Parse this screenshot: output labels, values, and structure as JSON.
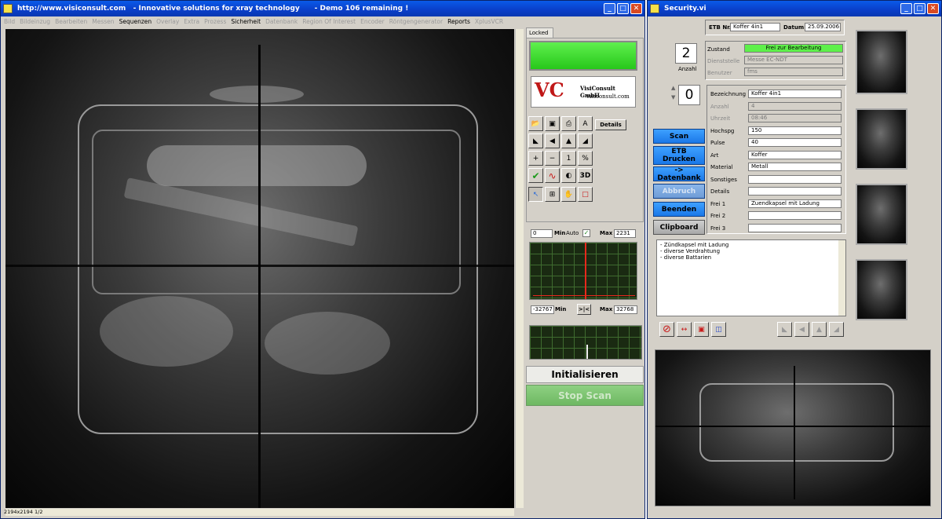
{
  "win1": {
    "url": "http://www.visiconsult.com",
    "tagline": "-  Innovative solutions for xray technology",
    "demo": "-  Demo 106 remaining !",
    "menu": [
      "Bild",
      "Bildeinzug",
      "Bearbeiten",
      "Messen",
      "Sequenzen",
      "Overlay",
      "Extra",
      "Prozess",
      "Sicherheit",
      "Datenbank",
      "Region Of Interest",
      "Encoder",
      "Röntgengenerator",
      "Reports",
      "XplusVCR"
    ],
    "menu_enabled": [
      "Sequenzen",
      "Sicherheit",
      "Reports"
    ],
    "status": "2194x2194 1/2",
    "locked_tab": "Locked",
    "logo": {
      "company": "VisiConsult GmbH",
      "web": "visiconsult.com"
    },
    "details_btn": "Details",
    "range1": {
      "min_val": "0",
      "min_lbl": "Min",
      "auto_lbl": "Auto",
      "max_lbl": "Max",
      "max_val": "2231"
    },
    "range2": {
      "min_val": "-32767",
      "min_lbl": "Min",
      "center_btn": ">|<",
      "max_lbl": "Max",
      "max_val": "32768"
    },
    "init_btn": "Initialisieren",
    "stop_btn": "Stop Scan"
  },
  "win2": {
    "title": "Security.vi",
    "etb_lbl": "ETB Nr.",
    "etb_val": "Koffer 4in1",
    "datum_lbl": "Datum",
    "datum_val": "25.09.2006",
    "anzahl_val": "2",
    "anzahl_lbl": "Anzahl",
    "zustand_lbl": "Zustand",
    "zustand_val": "Frei zur Bearbeitung",
    "dienststelle_lbl": "Dienststelle",
    "dienststelle_val": "Messe EC-NDT",
    "benutzer_lbl": "Benutzer",
    "benutzer_val": "fms",
    "counter_val": "0",
    "fields": [
      {
        "label": "Bezeichnung",
        "value": "Koffer 4in1",
        "dim": false
      },
      {
        "label": "Anzahl",
        "value": "4",
        "dim": true
      },
      {
        "label": "Uhrzeit",
        "value": "08:46",
        "dim": true
      },
      {
        "label": "Hochspg",
        "value": "150",
        "dim": false
      },
      {
        "label": "Pulse",
        "value": "40",
        "dim": false
      },
      {
        "label": "Art",
        "value": "Koffer",
        "dim": false
      },
      {
        "label": "Material",
        "value": "Metall",
        "dim": false
      },
      {
        "label": "Sonstiges",
        "value": "",
        "dim": false
      },
      {
        "label": "Details",
        "value": "",
        "dim": false
      },
      {
        "label": "Frei 1",
        "value": "Zuendkapsel mit Ladung",
        "dim": false
      },
      {
        "label": "Frei 2",
        "value": "",
        "dim": false
      },
      {
        "label": "Frei 3",
        "value": "",
        "dim": false
      }
    ],
    "buttons": {
      "scan": "Scan",
      "etb1": "ETB",
      "etb2": "Drucken",
      "datenbank": "-> Datenbank",
      "abbruch": "Abbruch",
      "beenden": "Beenden",
      "clipboard": "Clipboard"
    },
    "notes": [
      "- Zündkapsel mit Ladung",
      "- diverse Verdrahtung",
      "- diverse Battarien"
    ]
  },
  "colors": {
    "led": "#33d21f",
    "zustand": "#5ef04a",
    "blue_btn": "#2b8cf4",
    "titlebar": "#0a46d8",
    "signal": "#e8281c"
  }
}
